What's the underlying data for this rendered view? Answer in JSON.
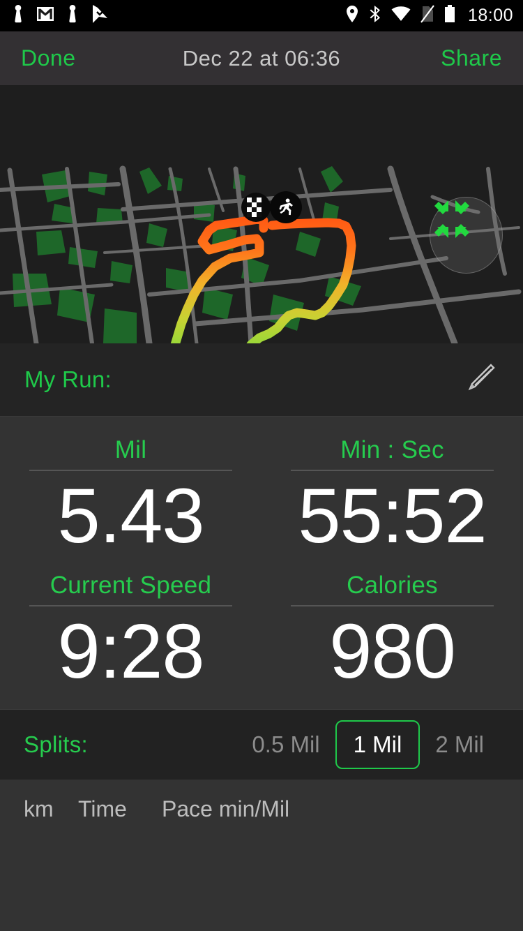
{
  "statusbar": {
    "time": "18:00",
    "left_icons": [
      "person-icon",
      "gmail-icon",
      "person-icon",
      "checkmark-flag-icon"
    ],
    "right_icons": [
      "location-pin-icon",
      "bluetooth-icon",
      "wifi-icon",
      "no-sim-icon",
      "battery-icon"
    ]
  },
  "navbar": {
    "done_label": "Done",
    "title": "Dec 22 at 06:36",
    "share_label": "Share"
  },
  "map": {
    "expand_icon": "expand-arrows-icon",
    "start_marker": "runner-icon",
    "finish_marker": "checkered-flag-icon",
    "route_color_start": "#ff6a1f",
    "route_color_end": "#6ee03c",
    "road_color": "#6a6a6a",
    "park_color": "#1f6b2a",
    "background_color": "#1e1e1e"
  },
  "run": {
    "title_label": "My Run:",
    "edit_icon": "pencil-icon"
  },
  "stats": [
    {
      "label": "Mil",
      "value": "5.43"
    },
    {
      "label": "Min : Sec",
      "value": "55:52"
    },
    {
      "label": "Current Speed",
      "value": "9:28"
    },
    {
      "label": "Calories",
      "value": "980"
    }
  ],
  "splits": {
    "label": "Splits:",
    "options": [
      {
        "label": "0.5 Mil",
        "selected": false
      },
      {
        "label": "1 Mil",
        "selected": true
      },
      {
        "label": "2 Mil",
        "selected": false
      }
    ]
  },
  "splits_table": {
    "columns": [
      "km",
      "Time",
      "Pace min/Mil"
    ],
    "rows": []
  },
  "colors": {
    "accent_green": "#1fc94a",
    "label_green": "#26cc4e",
    "nav_bg": "#333033",
    "panel_bg": "#333333",
    "band_bg": "#242424",
    "splits_bg": "#222222"
  }
}
